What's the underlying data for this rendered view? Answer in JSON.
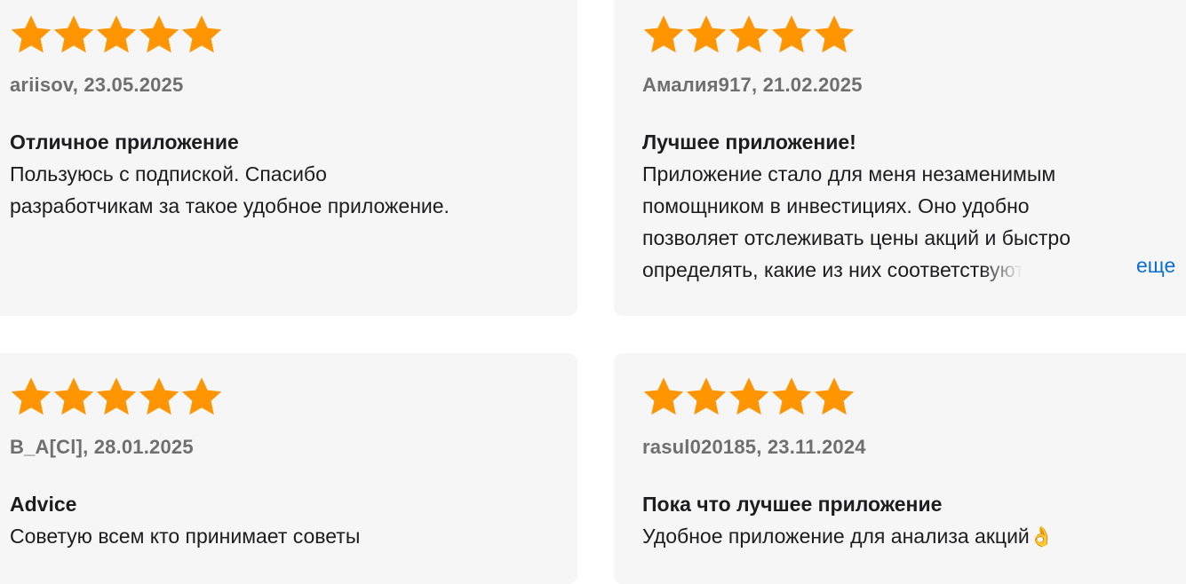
{
  "reviews": [
    {
      "rating": 5,
      "author_date": "ariisov, 23.05.2025",
      "title": "Отличное приложение",
      "lines": [
        "Пользуюсь с подпиской. Спасибо",
        "разработчикам за такое удобное приложение."
      ]
    },
    {
      "rating": 5,
      "author_date": "Амалия917, 21.02.2025",
      "title": "Лучшее приложение!",
      "lines": [
        "Приложение стало для меня незаменимым",
        "помощником в инвестициях. Оно удобно",
        "позволяет отслеживать цены акций и быстро",
        "определять, какие из них соответствуют"
      ],
      "more_label": "еще"
    },
    {
      "rating": 5,
      "author_date": "B_A[Cl], 28.01.2025",
      "title": "Advice",
      "lines": [
        "Советую всем кто принимает советы"
      ]
    },
    {
      "rating": 5,
      "author_date": "rasul020185, 23.11.2024",
      "title": "Пока что лучшее приложение",
      "lines": [
        "Удобное приложение для анализа акций"
      ],
      "emoji": "👌"
    }
  ],
  "colors": {
    "star": "#ff9500",
    "card_bg": "#f6f6f6",
    "link": "#0a6fd1"
  }
}
